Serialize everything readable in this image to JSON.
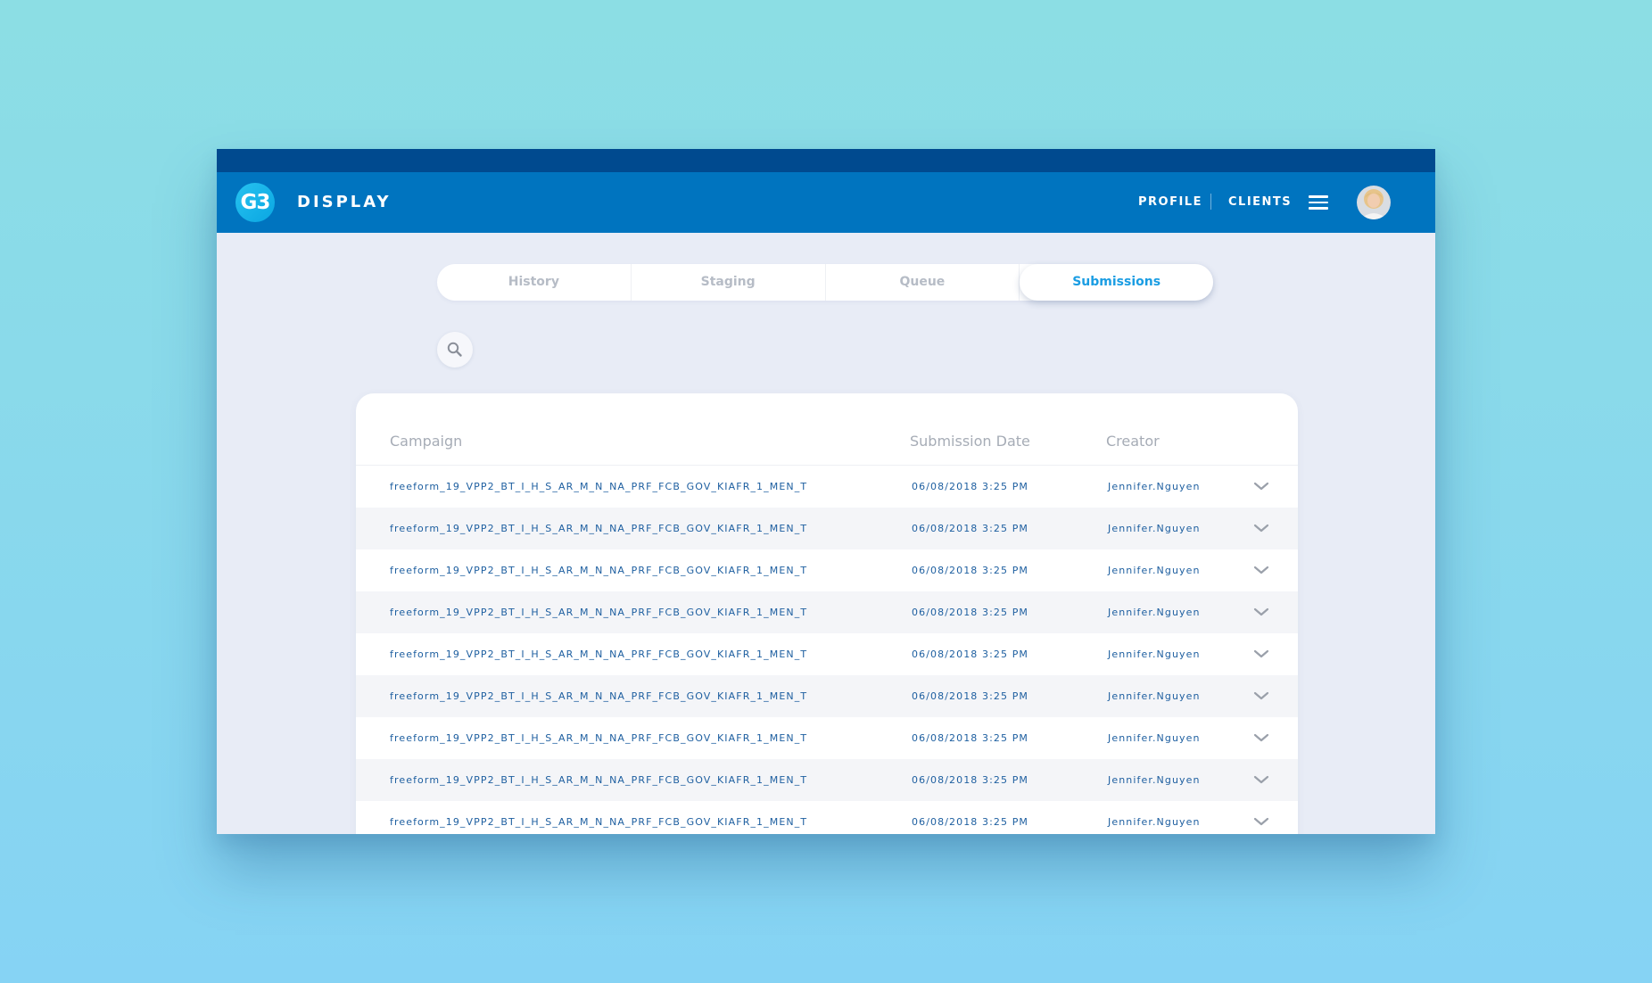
{
  "header": {
    "logo_text": "G3",
    "app_title": "DISPLAY",
    "nav": [
      {
        "label": "PROFILE"
      },
      {
        "label": "CLIENTS"
      }
    ],
    "menu_icon": "hamburger-menu-icon",
    "avatar": "user-avatar"
  },
  "tabs": [
    {
      "label": "History",
      "active": false
    },
    {
      "label": "Staging",
      "active": false
    },
    {
      "label": "Queue",
      "active": false
    },
    {
      "label": "Submissions",
      "active": true
    }
  ],
  "search": {
    "icon": "search-icon"
  },
  "table": {
    "columns": [
      "Campaign",
      "Submission Date",
      "Creator"
    ],
    "rows": [
      {
        "campaign": "freeform_19_VPP2_BT_I_H_S_AR_M_N_NA_PRF_FCB_GOV_KIAFR_1_MEN_T",
        "date": "06/08/2018 3:25 PM",
        "creator": "Jennifer.Nguyen"
      },
      {
        "campaign": "freeform_19_VPP2_BT_I_H_S_AR_M_N_NA_PRF_FCB_GOV_KIAFR_1_MEN_T",
        "date": "06/08/2018 3:25 PM",
        "creator": "Jennifer.Nguyen"
      },
      {
        "campaign": "freeform_19_VPP2_BT_I_H_S_AR_M_N_NA_PRF_FCB_GOV_KIAFR_1_MEN_T",
        "date": "06/08/2018 3:25 PM",
        "creator": "Jennifer.Nguyen"
      },
      {
        "campaign": "freeform_19_VPP2_BT_I_H_S_AR_M_N_NA_PRF_FCB_GOV_KIAFR_1_MEN_T",
        "date": "06/08/2018 3:25 PM",
        "creator": "Jennifer.Nguyen"
      },
      {
        "campaign": "freeform_19_VPP2_BT_I_H_S_AR_M_N_NA_PRF_FCB_GOV_KIAFR_1_MEN_T",
        "date": "06/08/2018 3:25 PM",
        "creator": "Jennifer.Nguyen"
      },
      {
        "campaign": "freeform_19_VPP2_BT_I_H_S_AR_M_N_NA_PRF_FCB_GOV_KIAFR_1_MEN_T",
        "date": "06/08/2018 3:25 PM",
        "creator": "Jennifer.Nguyen"
      },
      {
        "campaign": "freeform_19_VPP2_BT_I_H_S_AR_M_N_NA_PRF_FCB_GOV_KIAFR_1_MEN_T",
        "date": "06/08/2018 3:25 PM",
        "creator": "Jennifer.Nguyen"
      },
      {
        "campaign": "freeform_19_VPP2_BT_I_H_S_AR_M_N_NA_PRF_FCB_GOV_KIAFR_1_MEN_T",
        "date": "06/08/2018 3:25 PM",
        "creator": "Jennifer.Nguyen"
      },
      {
        "campaign": "freeform_19_VPP2_BT_I_H_S_AR_M_N_NA_PRF_FCB_GOV_KIAFR_1_MEN_T",
        "date": "06/08/2018 3:25 PM",
        "creator": "Jennifer.Nguyen"
      }
    ],
    "row_icon": "chevron-down-icon"
  },
  "colors": {
    "page_bg_top": "#8cdee4",
    "page_bg_bottom": "#86d3f4",
    "top_strip": "#004a8f",
    "header_bg": "#0074bf",
    "logo_accent": "#1ab4ea",
    "active_tab_text": "#1a9de3",
    "inactive_tab_text": "#b6bcc6",
    "row_text": "#1e5fa0",
    "alt_row_bg": "#f4f5f8",
    "content_bg": "#e8ecf6"
  }
}
